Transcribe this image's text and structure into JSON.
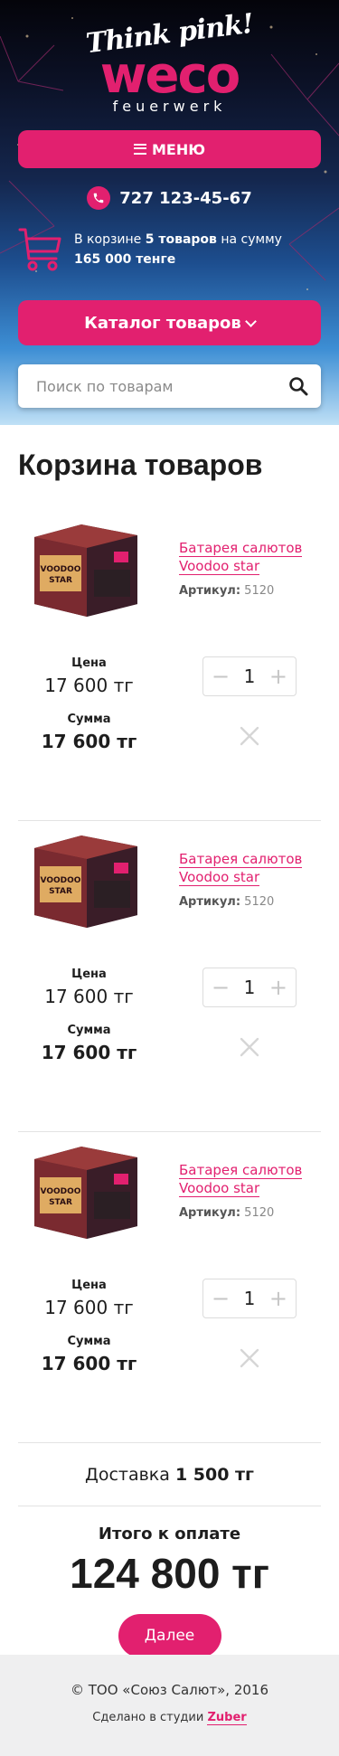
{
  "header": {
    "logo_tagline": "Think pink!",
    "logo_name": "weco",
    "logo_sub": "feuerwerk",
    "menu_label": "МЕНЮ",
    "phone": "727 123-45-67",
    "cart_text_1": "В корзине",
    "cart_count": "5 товаров",
    "cart_text_2": "на сумму",
    "cart_total": "165 000 тенге",
    "catalog_label": "Каталог товаров",
    "search_placeholder": "Поиск по товарам"
  },
  "main": {
    "title": "Корзина товаров",
    "labels": {
      "price": "Цена",
      "sum": "Сумма",
      "article": "Артикул:"
    },
    "items": [
      {
        "name": "Батарея салютов Voodoo star",
        "article": "5120",
        "price": "17 600 тг",
        "qty": "1",
        "sum": "17 600 тг",
        "box_text": "VOODOO STAR"
      },
      {
        "name": "Батарея салютов Voodoo star",
        "article": "5120",
        "price": "17 600 тг",
        "qty": "1",
        "sum": "17 600 тг",
        "box_text": "VOODOO STAR"
      },
      {
        "name": "Батарея салютов Voodoo star",
        "article": "5120",
        "price": "17 600 тг",
        "qty": "1",
        "sum": "17 600 тг",
        "box_text": "VOODOO STAR"
      }
    ],
    "delivery_label": "Доставка",
    "delivery_value": "1 500 тг",
    "total_label": "Итого к оплате",
    "total_value": "124 800 тг",
    "next_label": "Далее"
  },
  "footer": {
    "copyright": "© ТОО «Союз Салют», 2016",
    "studio_text": "Сделано в студии",
    "studio_name": "Zuber"
  },
  "colors": {
    "accent": "#e2206f",
    "text": "#1d1d1d",
    "footer_bg": "#efeff0"
  },
  "icons": [
    "menu-icon",
    "phone-icon",
    "cart-icon",
    "chevron-down-icon",
    "search-icon",
    "minus-icon",
    "plus-icon",
    "close-icon"
  ]
}
